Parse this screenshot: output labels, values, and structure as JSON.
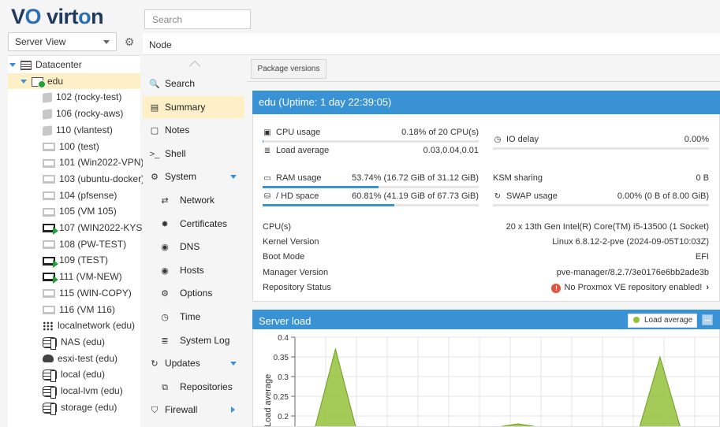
{
  "brand": {
    "logo_text_a": "V",
    "logo_text_o": "O",
    "logo_text_b": " virt",
    "logo_text_c": "o",
    "logo_text_d": "n"
  },
  "search": {
    "placeholder": "Search"
  },
  "view_selector": {
    "selected": "Server View"
  },
  "breadcrumb": "Node",
  "tree": [
    {
      "label": "Datacenter",
      "icon": "datacenter-icon",
      "expanded": true
    },
    {
      "label": "edu",
      "icon": "node-online-icon",
      "expanded": true,
      "selected": true
    },
    {
      "label": "102 (rocky-test)",
      "icon": "container-icon"
    },
    {
      "label": "106 (rocky-aws)",
      "icon": "container-icon"
    },
    {
      "label": "110 (vlantest)",
      "icon": "container-icon"
    },
    {
      "label": "100 (test)",
      "icon": "vm-stopped-icon"
    },
    {
      "label": "101 (Win2022-VPN)",
      "icon": "vm-stopped-icon"
    },
    {
      "label": "103 (ubuntu-docker)",
      "icon": "vm-stopped-icon"
    },
    {
      "label": "104 (pfsense)",
      "icon": "vm-stopped-icon"
    },
    {
      "label": "105 (VM 105)",
      "icon": "vm-stopped-icon"
    },
    {
      "label": "107 (WIN2022-KYS)",
      "icon": "vm-running-icon"
    },
    {
      "label": "108 (PW-TEST)",
      "icon": "vm-stopped-icon"
    },
    {
      "label": "109 (TEST)",
      "icon": "vm-running-icon"
    },
    {
      "label": "111 (VM-NEW)",
      "icon": "vm-running-icon"
    },
    {
      "label": "115 (WIN-COPY)",
      "icon": "vm-stopped-icon"
    },
    {
      "label": "116 (VM 116)",
      "icon": "vm-stopped-icon"
    },
    {
      "label": "localnetwork (edu)",
      "icon": "sdn-grid-icon"
    },
    {
      "label": "NAS (edu)",
      "icon": "storage-shared-icon"
    },
    {
      "label": "esxi-test (edu)",
      "icon": "cloud-storage-icon"
    },
    {
      "label": "local (edu)",
      "icon": "storage-shared-icon"
    },
    {
      "label": "local-lvm (edu)",
      "icon": "storage-shared-icon"
    },
    {
      "label": "storage (edu)",
      "icon": "storage-shared-icon"
    }
  ],
  "nav": [
    {
      "label": "Search",
      "icon": "search-icon",
      "glyph": "🔍"
    },
    {
      "label": "Summary",
      "icon": "book-icon",
      "glyph": "▤",
      "selected": true
    },
    {
      "label": "Notes",
      "icon": "notes-icon",
      "glyph": "▢"
    },
    {
      "label": "Shell",
      "icon": "terminal-icon",
      "glyph": ">_"
    },
    {
      "label": "System",
      "icon": "cogs-icon",
      "glyph": "⚙",
      "expanded": true
    },
    {
      "label": "Network",
      "icon": "network-icon",
      "glyph": "⇄",
      "sub": true
    },
    {
      "label": "Certificates",
      "icon": "certificate-icon",
      "glyph": "✸",
      "sub": true
    },
    {
      "label": "DNS",
      "icon": "globe-icon",
      "glyph": "◉",
      "sub": true
    },
    {
      "label": "Hosts",
      "icon": "globe-icon",
      "glyph": "◉",
      "sub": true
    },
    {
      "label": "Options",
      "icon": "gear-icon",
      "glyph": "⚙",
      "sub": true
    },
    {
      "label": "Time",
      "icon": "clock-icon",
      "glyph": "◷",
      "sub": true
    },
    {
      "label": "System Log",
      "icon": "list-icon",
      "glyph": "≣",
      "sub": true
    },
    {
      "label": "Updates",
      "icon": "refresh-icon",
      "glyph": "↻",
      "expanded": true
    },
    {
      "label": "Repositories",
      "icon": "repository-icon",
      "glyph": "⧉",
      "sub": true
    },
    {
      "label": "Firewall",
      "icon": "shield-icon",
      "glyph": "⛉",
      "collapsed": true
    }
  ],
  "toolbar": {
    "package_versions": "Package versions"
  },
  "status": {
    "title": "edu (Uptime: 1 day 22:39:05)",
    "cpu": {
      "label": "CPU usage",
      "value": "0.18% of 20 CPU(s)",
      "fraction": 0.0018
    },
    "load": {
      "label": "Load average",
      "value": "0.03,0.04,0.01"
    },
    "io": {
      "label": "IO delay",
      "value": "0.00%",
      "fraction": 0
    },
    "ram": {
      "label": "RAM usage",
      "value": "53.74% (16.72 GiB of 31.12 GiB)",
      "fraction": 0.5374
    },
    "ksm": {
      "label": "KSM sharing",
      "value": "0 B"
    },
    "hd": {
      "label": "/ HD space",
      "value": "60.81% (41.19 GiB of 67.73 GiB)",
      "fraction": 0.6081
    },
    "swap": {
      "label": "SWAP usage",
      "value": "0.00% (0 B of 8.00 GiB)",
      "fraction": 0
    },
    "details": [
      {
        "label": "CPU(s)",
        "value": "20 x 13th Gen Intel(R) Core(TM) i5-13500 (1 Socket)"
      },
      {
        "label": "Kernel Version",
        "value": "Linux 6.8.12-2-pve (2024-09-05T10:03Z)"
      },
      {
        "label": "Boot Mode",
        "value": "EFI"
      },
      {
        "label": "Manager Version",
        "value": "pve-manager/8.2.7/3e0176e6bb2ade3b"
      },
      {
        "label": "Repository Status",
        "value": "No Proxmox VE repository enabled!"
      }
    ]
  },
  "server_load": {
    "title": "Server load",
    "legend_label": "Load average"
  },
  "chart_data": {
    "type": "area",
    "ylabel": "Load average",
    "ylim": [
      0.15,
      0.4
    ],
    "yticks": [
      "0.4",
      "0.35",
      "0.3",
      "0.25",
      "0.2"
    ],
    "series": [
      {
        "name": "Load average",
        "color": "#94c13a",
        "values": [
          0.1,
          0.1,
          0.37,
          0.1,
          0.1,
          0.1,
          0.1,
          0.1,
          0.1,
          0.1,
          0.1,
          0.18,
          0.1,
          0.1,
          0.1,
          0.1,
          0.1,
          0.1,
          0.35,
          0.1,
          0.1,
          0.1
        ]
      }
    ]
  }
}
